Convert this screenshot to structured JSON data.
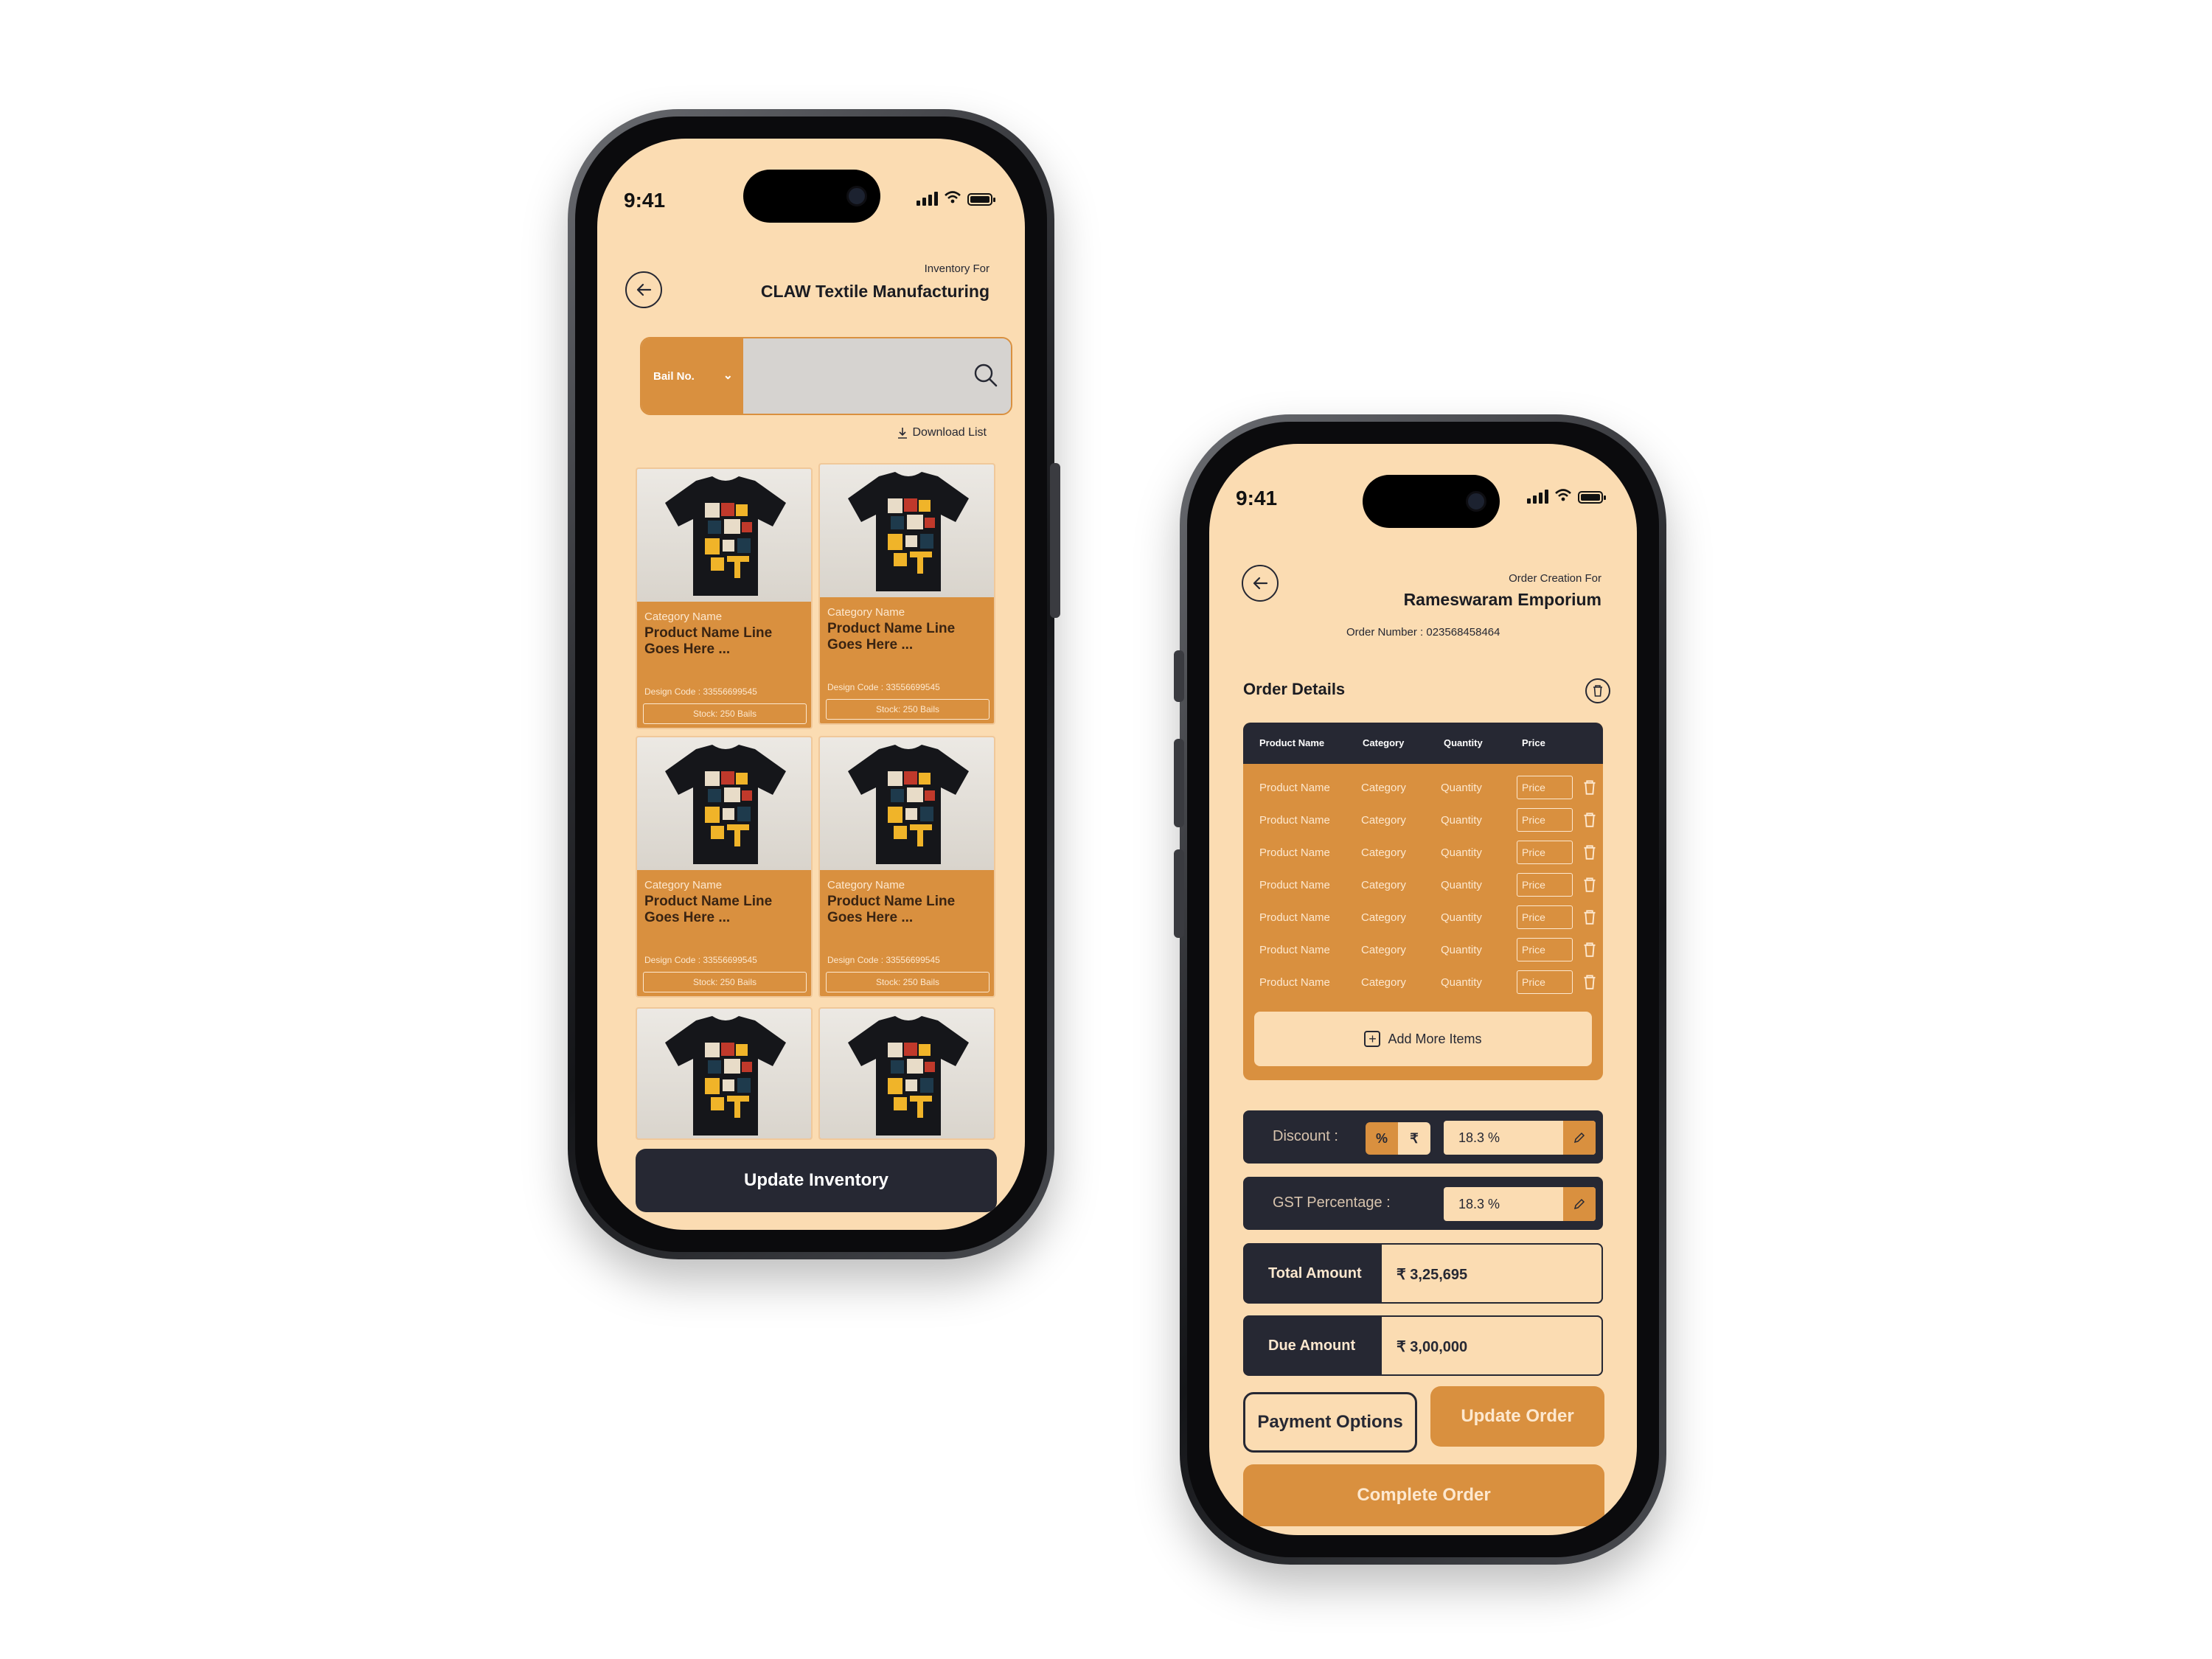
{
  "status_bar": {
    "time": "9:41"
  },
  "inventory_screen": {
    "header_small": "Inventory For",
    "header_title": "CLAW Textile Manufacturing",
    "search": {
      "category_label": "Bail No.",
      "placeholder": ""
    },
    "download_label": "Download List",
    "cards": [
      {
        "category": "Category Name",
        "name": "Product Name Line Goes Here ...",
        "design_code": "Design Code : 33556699545",
        "stock": "Stock: 250 Bails"
      },
      {
        "category": "Category Name",
        "name": "Product Name Line Goes Here ...",
        "design_code": "Design Code : 33556699545",
        "stock": "Stock: 250 Bails"
      },
      {
        "category": "Category Name",
        "name": "Product Name Line Goes Here ...",
        "design_code": "Design Code : 33556699545",
        "stock": "Stock: 250 Bails"
      },
      {
        "category": "Category Name",
        "name": "Product Name Line Goes Here ...",
        "design_code": "Design Code : 33556699545",
        "stock": "Stock: 250 Bails"
      }
    ],
    "update_button": "Update Inventory"
  },
  "order_screen": {
    "header_small": "Order Creation For",
    "header_title": "Rameswaram Emporium",
    "order_number": "Order Number : 023568458464",
    "section_title": "Order Details",
    "table": {
      "headers": [
        "Product Name",
        "Category",
        "Quantity",
        "Price"
      ],
      "rows": [
        {
          "product": "Product Name",
          "category": "Category",
          "quantity": "Quantity",
          "price": "Price"
        },
        {
          "product": "Product Name",
          "category": "Category",
          "quantity": "Quantity",
          "price": "Price"
        },
        {
          "product": "Product Name",
          "category": "Category",
          "quantity": "Quantity",
          "price": "Price"
        },
        {
          "product": "Product Name",
          "category": "Category",
          "quantity": "Quantity",
          "price": "Price"
        },
        {
          "product": "Product Name",
          "category": "Category",
          "quantity": "Quantity",
          "price": "Price"
        },
        {
          "product": "Product Name",
          "category": "Category",
          "quantity": "Quantity",
          "price": "Price"
        },
        {
          "product": "Product Name",
          "category": "Category",
          "quantity": "Quantity",
          "price": "Price"
        }
      ],
      "add_more": "Add More Items"
    },
    "discount": {
      "label": "Discount :",
      "percent_symbol": "%",
      "rupee_symbol": "₹",
      "value": "18.3 %"
    },
    "gst": {
      "label": "GST Percentage :",
      "value": "18.3 %"
    },
    "total": {
      "label": "Total Amount",
      "value": "₹ 3,25,695"
    },
    "due": {
      "label": "Due Amount",
      "value": "₹ 3,00,000"
    },
    "payment_button": "Payment Options",
    "update_button": "Update Order",
    "complete_button": "Complete Order"
  },
  "colors": {
    "background": "#fbdcb2",
    "accent": "#d9903f",
    "dark": "#262833"
  }
}
